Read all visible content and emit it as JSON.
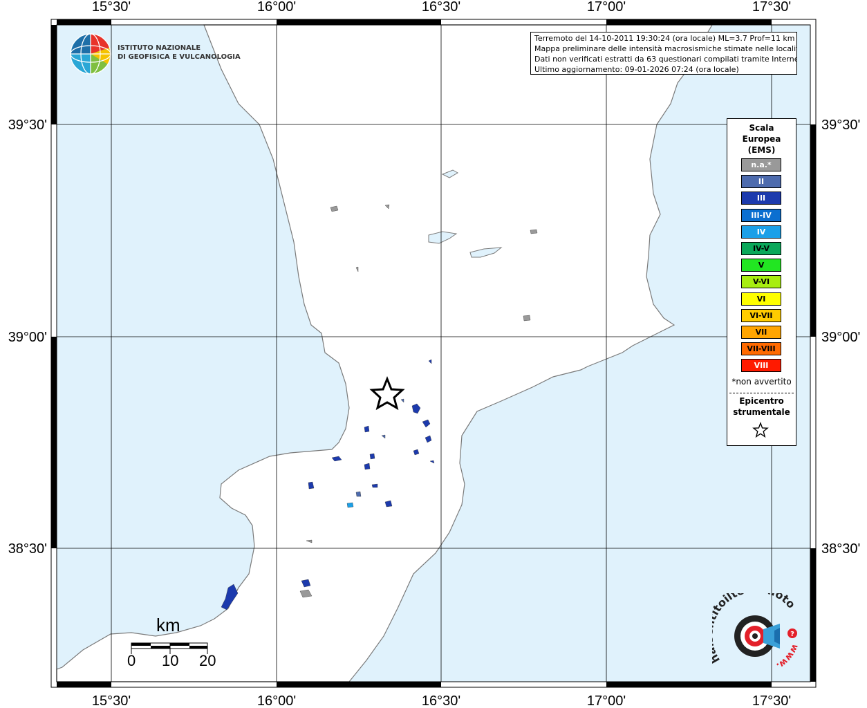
{
  "map": {
    "lon_ticks": [
      "15°30'",
      "16°00'",
      "16°30'",
      "17°00'",
      "17°30'"
    ],
    "lat_ticks": [
      "39°30'",
      "39°00'",
      "38°30'"
    ],
    "colors": {
      "sea": "#e0f2fc",
      "land": "#ffffff",
      "grid": "#000000",
      "coast": "#7a7a7a"
    }
  },
  "info": {
    "line1": "Terremoto del 14-10-2011 19:30:24 (ora locale) ML=3.7 Prof=11 km",
    "line2": "Mappa preliminare delle intensità macrosismiche stimate nelle località",
    "line3": "Dati non verificati estratti da 63 questionari compilati tramite Internet.",
    "line4": "Ultimo aggiornamento: 09-01-2026 07:24 (ora locale)"
  },
  "logo": {
    "ingv_line1": "ISTITUTO NAZIONALE",
    "ingv_line2": "DI GEOFISICA E VULCANOLOGIA",
    "hsit_text": "haisentitoilterremoto.it",
    "hsit_www": "www."
  },
  "legend": {
    "title1": "Scala",
    "title2": "Europea",
    "title3": "(EMS)",
    "items": [
      {
        "label": "n.a.*",
        "color": "#999999"
      },
      {
        "label": "II",
        "color": "#4d6bae"
      },
      {
        "label": "III",
        "color": "#1c3aad"
      },
      {
        "label": "III-IV",
        "color": "#0b6fd0"
      },
      {
        "label": "IV",
        "color": "#1ba0e8"
      },
      {
        "label": "IV-V",
        "color": "#0aa85a"
      },
      {
        "label": "V",
        "color": "#22e622"
      },
      {
        "label": "V-VI",
        "color": "#a8ee10"
      },
      {
        "label": "VI",
        "color": "#ffff00"
      },
      {
        "label": "VI-VII",
        "color": "#ffcc00"
      },
      {
        "label": "VII",
        "color": "#ffa500"
      },
      {
        "label": "VII-VIII",
        "color": "#ff6a00"
      },
      {
        "label": "VIII",
        "color": "#ff1a00"
      }
    ],
    "note": "*non avvertito",
    "epicentre1": "Epicentro",
    "epicentre2": "strumentale"
  },
  "scale_bar": {
    "unit": "km",
    "labels": [
      "0",
      "10",
      "20"
    ]
  }
}
